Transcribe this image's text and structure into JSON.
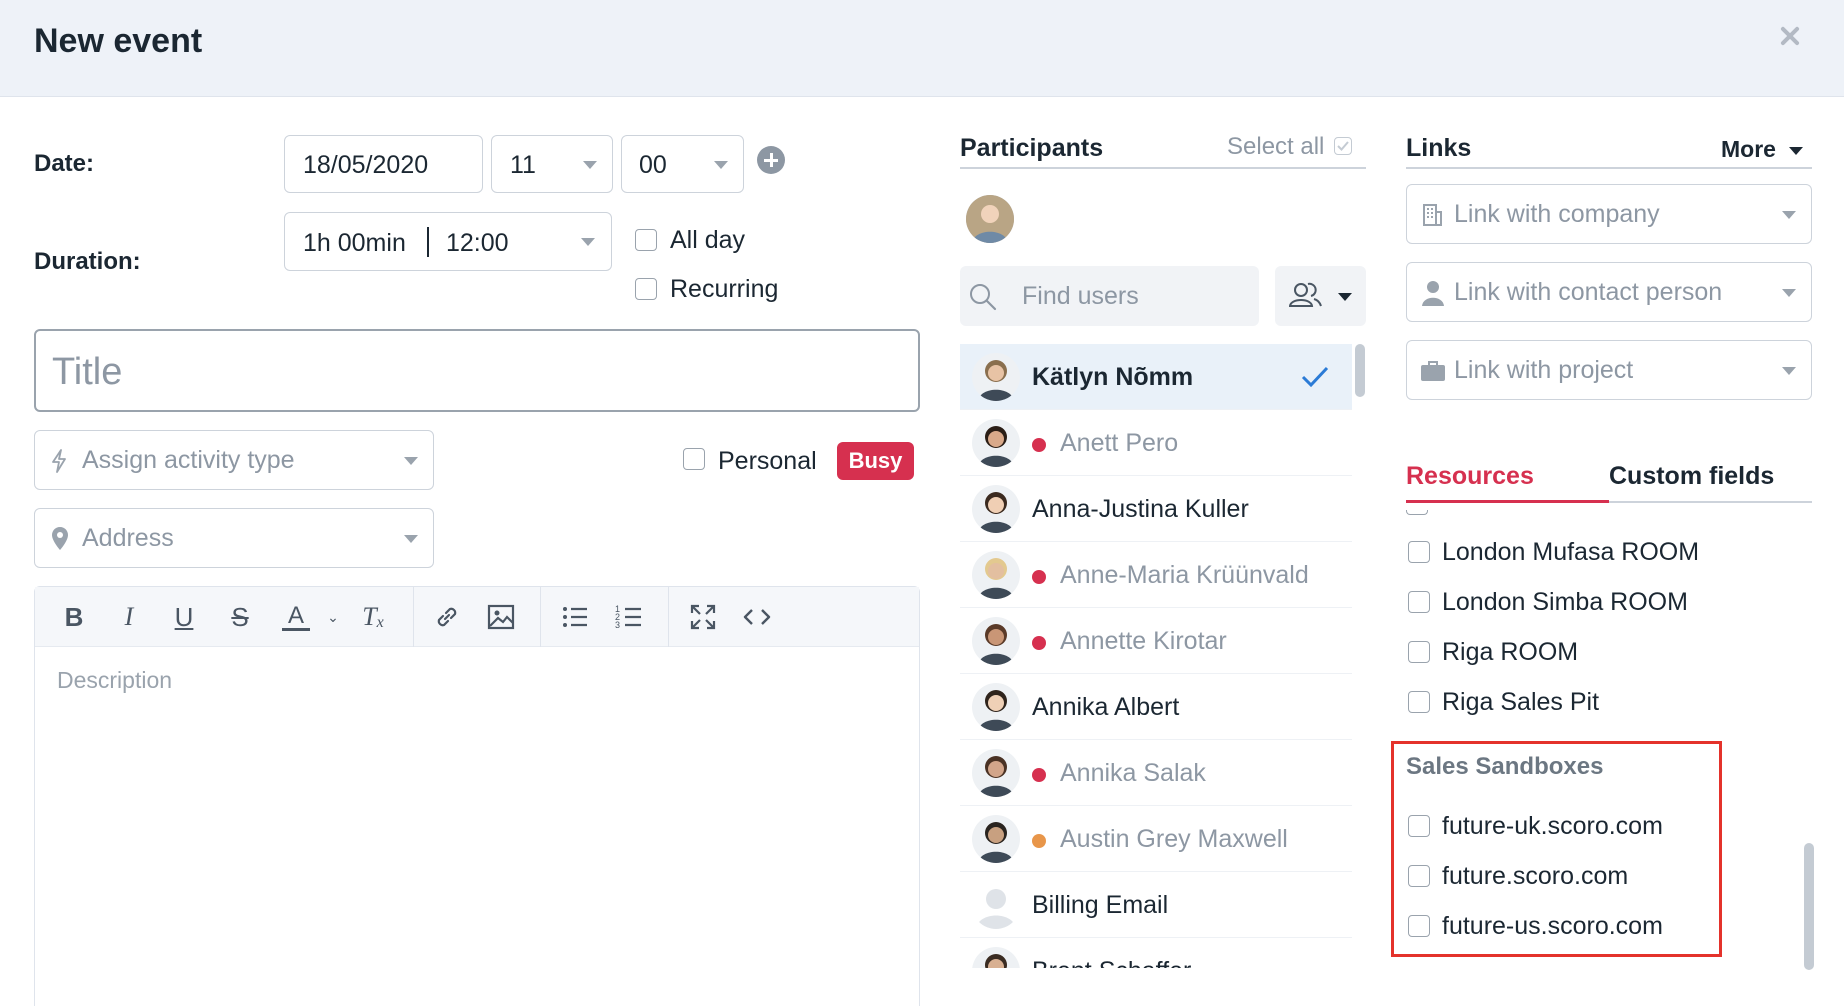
{
  "header": {
    "title": "New event"
  },
  "form": {
    "date_label": "Date:",
    "date_value": "18/05/2020",
    "hour_value": "11",
    "minute_value": "00",
    "duration_label": "Duration:",
    "duration_value": "1h 00min",
    "end_time_value": "12:00",
    "all_day_label": "All day",
    "recurring_label": "Recurring",
    "title_placeholder": "Title",
    "activity_placeholder": "Assign activity type",
    "personal_label": "Personal",
    "busy_badge": "Busy",
    "address_placeholder": "Address",
    "description_placeholder": "Description"
  },
  "editor_toolbar": [
    "bold-icon",
    "italic-icon",
    "underline-icon",
    "strikethrough-icon",
    "text-color-icon",
    "clear-format-icon",
    "link-icon",
    "image-icon",
    "bullet-list-icon",
    "numbered-list-icon",
    "fullscreen-icon",
    "code-icon"
  ],
  "participants": {
    "title": "Participants",
    "select_all": "Select all",
    "search_placeholder": "Find users",
    "list": [
      {
        "name": "Kätlyn Nõmm",
        "status": "selected"
      },
      {
        "name": "Anett Pero",
        "status": "busy",
        "dot_color": "#d6304f"
      },
      {
        "name": "Anna-Justina Kuller",
        "status": "available"
      },
      {
        "name": "Anne-Maria Krüünvald",
        "status": "busy",
        "dot_color": "#d6304f"
      },
      {
        "name": "Annette Kirotar",
        "status": "busy",
        "dot_color": "#d6304f"
      },
      {
        "name": "Annika Albert",
        "status": "available"
      },
      {
        "name": "Annika Salak",
        "status": "busy",
        "dot_color": "#d6304f"
      },
      {
        "name": "Austin Grey Maxwell",
        "status": "tentative",
        "dot_color": "#e8964a"
      },
      {
        "name": "Billing Email",
        "status": "available"
      },
      {
        "name": "Brent Schaffer",
        "status": "available"
      }
    ]
  },
  "links": {
    "title": "Links",
    "more_label": "More",
    "company_placeholder": "Link with company",
    "contact_placeholder": "Link with contact person",
    "project_placeholder": "Link with project"
  },
  "tabs": {
    "resources": "Resources",
    "custom_fields": "Custom fields"
  },
  "resources": {
    "rooms": [
      "London Mufasa ROOM",
      "London Simba ROOM",
      "Riga ROOM",
      "Riga Sales Pit"
    ],
    "sandbox_group_title": "Sales Sandboxes",
    "sandboxes": [
      "future-uk.scoro.com",
      "future.scoro.com",
      "future-us.scoro.com"
    ]
  },
  "colors": {
    "accent_red": "#d6304f",
    "selected_blue": "#2b7bd6",
    "row_selected_bg": "#e9f1f9"
  }
}
